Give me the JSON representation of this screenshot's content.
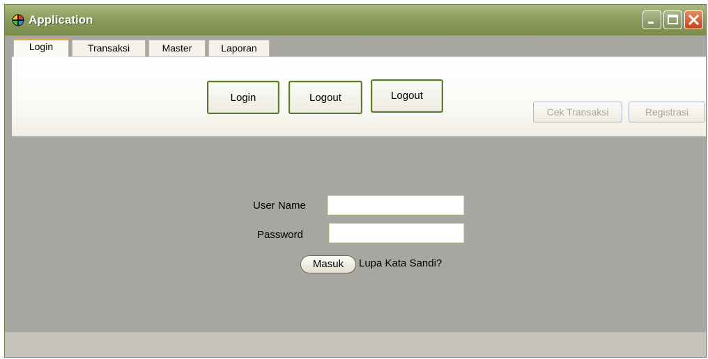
{
  "window": {
    "title": "Application",
    "controls": [
      "minimize-icon",
      "maximize-icon",
      "close-icon"
    ],
    "titlebar_color": "#8c9d5c",
    "close_color": "#c8431b"
  },
  "tabs": [
    {
      "label": "Login",
      "active": true
    },
    {
      "label": "Transaksi",
      "active": false
    },
    {
      "label": "Master",
      "active": false
    },
    {
      "label": "Laporan",
      "active": false
    }
  ],
  "toolbar": {
    "login_label": "Login",
    "logout_label": "Logout",
    "logout2_label": "Logout",
    "cek_transaksi_label": "Cek Transaksi",
    "registrasi_label": "Registrasi"
  },
  "login_form": {
    "username_label": "User Name",
    "username_value": "",
    "password_label": "Password",
    "password_value": "",
    "submit_label": "Masuk",
    "forgot_label": "Lupa Kata Sandi?"
  }
}
